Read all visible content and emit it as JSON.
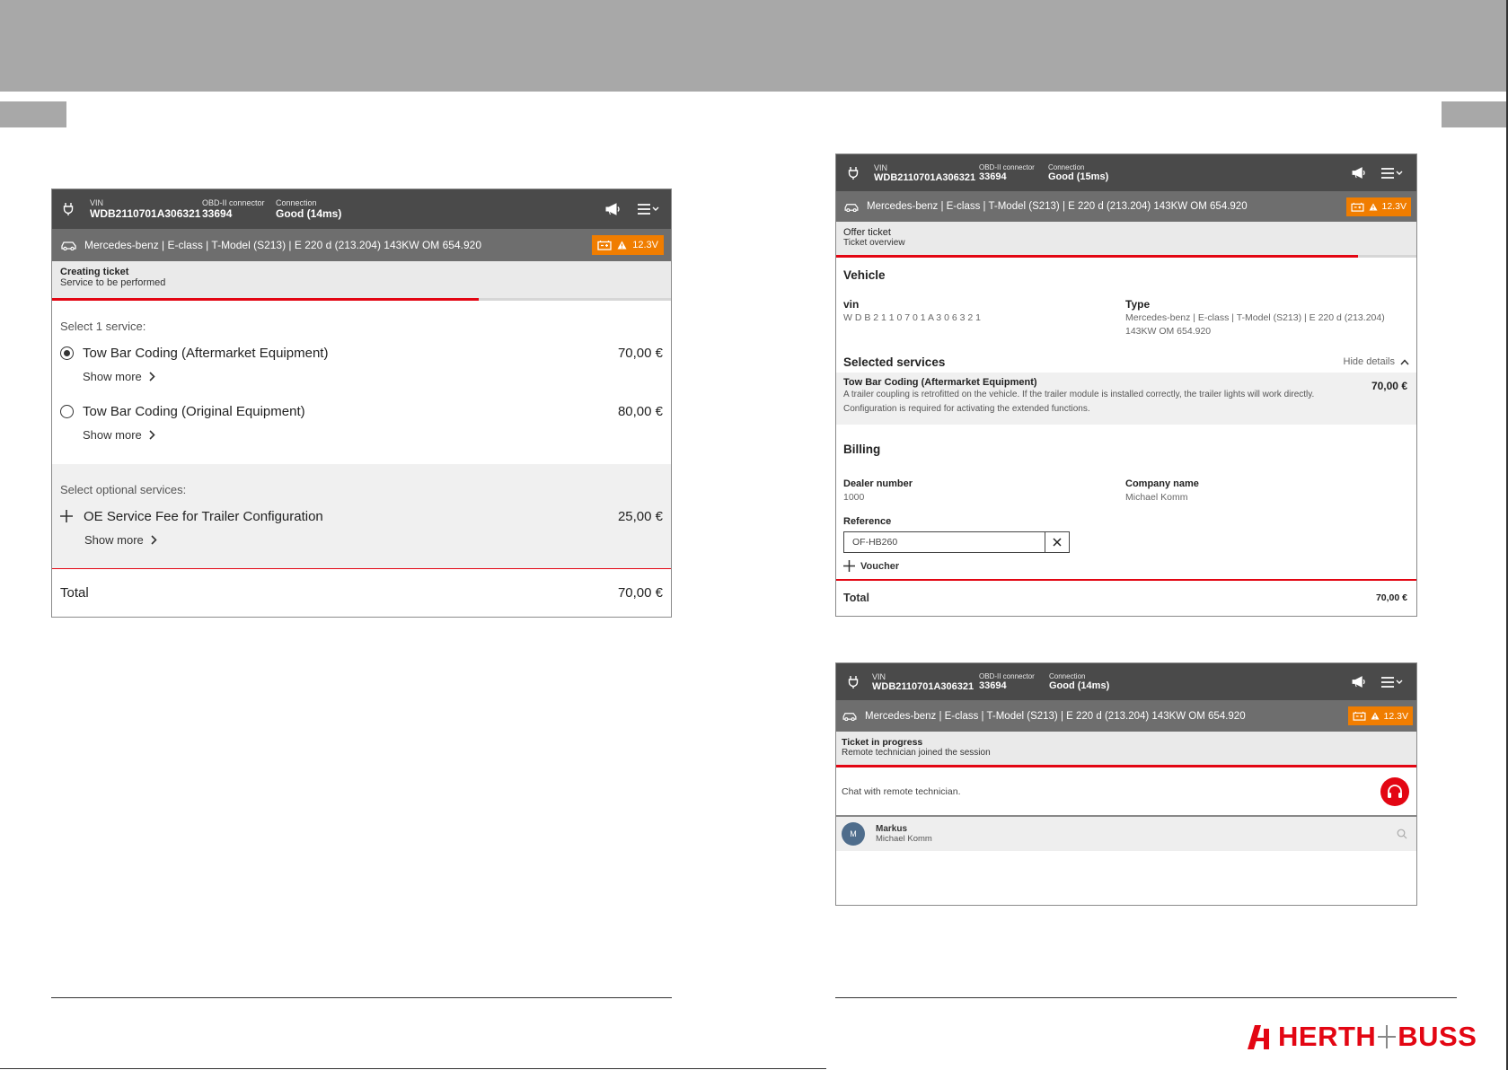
{
  "header": {
    "vin_label": "VIN",
    "vin": "WDB2110701A306321",
    "obd_label": "OBD-II connector",
    "obd": "33694",
    "conn_label": "Connection"
  },
  "vehicle": {
    "description": "Mercedes-benz | E-class | T-Model (S213) | E 220 d (213.204) 143KW OM 654.920",
    "battery": "12.3V"
  },
  "left": {
    "connection": "Good (14ms)",
    "status_title": "Creating ticket",
    "status_sub": "Service to be performed",
    "progress": 0.69,
    "select_label": "Select 1 service:",
    "services": [
      {
        "name": "Tow Bar Coding (Aftermarket Equipment)",
        "price": "70,00 €",
        "selected": true,
        "more": "Show more"
      },
      {
        "name": "Tow Bar Coding (Original Equipment)",
        "price": "80,00 €",
        "selected": false,
        "more": "Show more"
      }
    ],
    "optional_label": "Select optional services:",
    "optional": {
      "name": "OE Service Fee for Trailer Configuration",
      "price": "25,00 €",
      "more": "Show more"
    },
    "total_label": "Total",
    "total": "70,00 €"
  },
  "offer": {
    "connection": "Good (15ms)",
    "status_title": "Offer ticket",
    "status_sub": "Ticket overview",
    "progress": 0.9,
    "vehicle_heading": "Vehicle",
    "vin_label": "vin",
    "vin_spaced": "W D B 2 1 1 0 7 0 1 A 3 0 6 3 2 1",
    "type_label": "Type",
    "type_line1": "Mercedes-benz | E-class | T-Model (S213) | E 220 d (213.204)",
    "type_line2": "143KW OM 654.920",
    "services_heading": "Selected services",
    "hide_details": "Hide details",
    "service_name": "Tow Bar Coding (Aftermarket Equipment)",
    "service_desc": "A trailer coupling is retrofitted on the vehicle. If the trailer module is installed correctly, the trailer lights will work directly. Configuration is required for activating the extended functions.",
    "service_price": "70,00 €",
    "billing_heading": "Billing",
    "dealer_label": "Dealer number",
    "dealer": "1000",
    "company_label": "Company name",
    "company": "Michael Komm",
    "reference_label": "Reference",
    "reference_value": "OF-HB260",
    "voucher": "Voucher",
    "total_label": "Total",
    "total": "70,00 €"
  },
  "progress_panel": {
    "connection": "Good (14ms)",
    "status_title": "Ticket in progress",
    "status_sub": "Remote technician joined the session",
    "chat_label": "Chat with remote technician.",
    "contact_initial": "M",
    "contact_name": "Markus",
    "contact_sub": "Michael Komm"
  },
  "brand": {
    "word1": "HERTH",
    "word2": "BUSS",
    "color": "#e30613"
  },
  "colors": {
    "header": "#4a4a4a",
    "vehicle_bar": "#6e6e6e",
    "accent": "#e30613",
    "battery": "#f07d00"
  }
}
